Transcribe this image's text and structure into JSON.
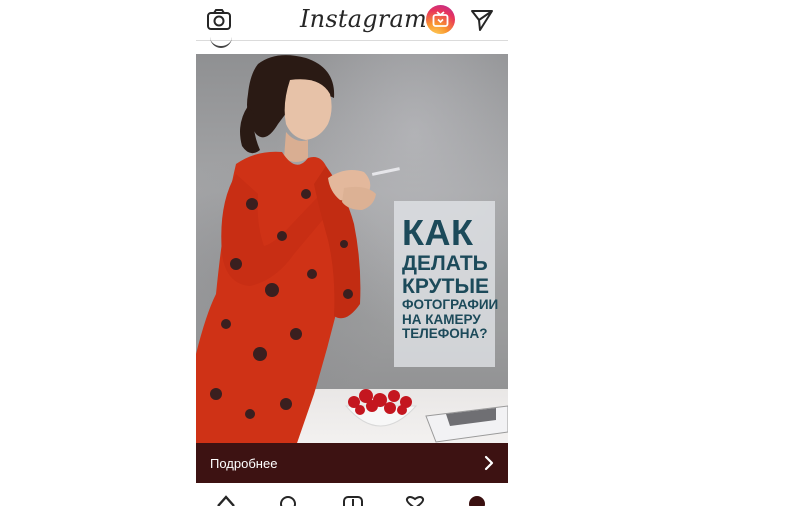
{
  "header": {
    "logo_text": "Instagram",
    "icons": [
      "camera-icon",
      "igtv-icon",
      "direct-send-icon"
    ]
  },
  "post": {
    "headline": {
      "line1": "КАК",
      "line2": "ДЕЛАТЬ",
      "line3": "КРУТЫЕ",
      "line4": "ФОТОГРАФИИ",
      "line5": "НА КАМЕРУ",
      "line6": "ТЕЛЕФОНА?"
    },
    "headline_color": "#1c4a5a",
    "cta_label": "Подробнее",
    "cta_color": "#3d1212"
  },
  "nav": {
    "icons": [
      "home-icon",
      "search-icon",
      "add-post-icon",
      "activity-heart-icon",
      "profile-avatar"
    ]
  }
}
